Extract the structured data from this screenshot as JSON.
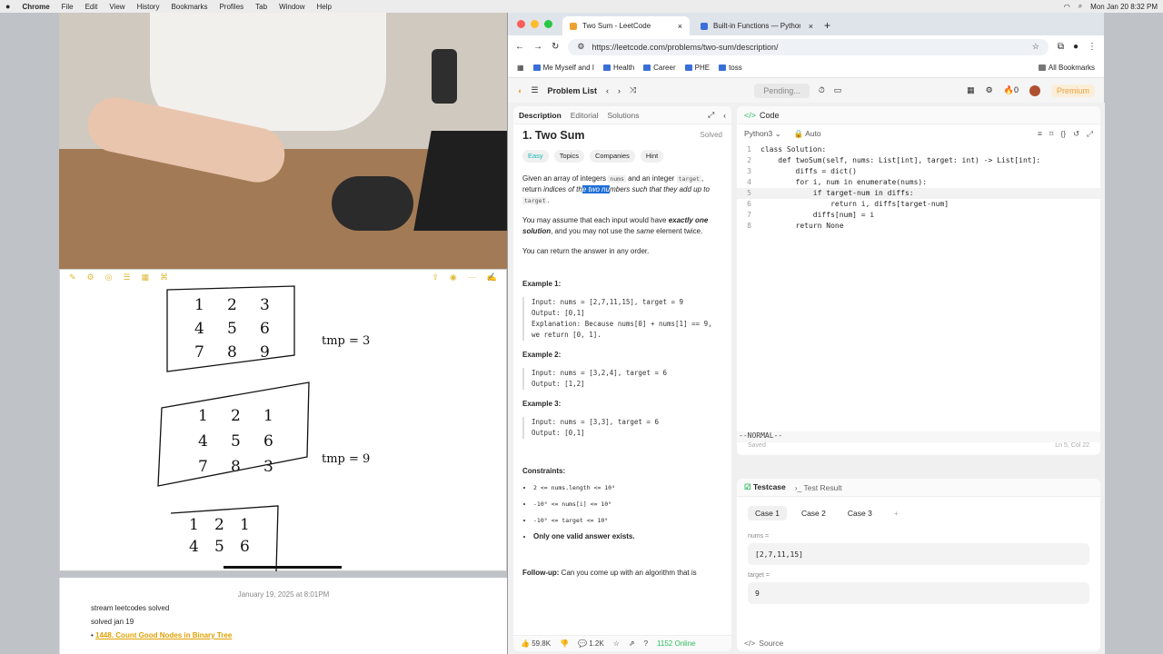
{
  "menubar": {
    "app": "Chrome",
    "items": [
      "File",
      "Edit",
      "View",
      "History",
      "Bookmarks",
      "Profiles",
      "Tab",
      "Window",
      "Help"
    ],
    "datetime": "Mon Jan 20  8:32 PM"
  },
  "notes": {
    "date": "January 19, 2025 at 8:01PM",
    "line1": "stream leetcodes solved",
    "line2": "solved jan 19",
    "link": "1448. Count Good Nodes in Binary Tree"
  },
  "whiteboard": {
    "grid1_label": "tmp = 3",
    "grid2_label": "tmp = 9",
    "grid1": [
      "1",
      "2",
      "3",
      "4",
      "5",
      "6",
      "7",
      "8",
      "9"
    ],
    "grid2": [
      "1",
      "2",
      "1",
      "4",
      "5",
      "6",
      "7",
      "8",
      "3"
    ],
    "grid3": [
      "1",
      "2",
      "1",
      "4",
      "5",
      "6"
    ]
  },
  "browser": {
    "tab1": "Two Sum - LeetCode",
    "tab2": "Built-in Functions — Python 3",
    "url": "https://leetcode.com/problems/two-sum/description/",
    "bookmarks": [
      "Me Myself and I",
      "Health",
      "Career",
      "PHE",
      "toss"
    ],
    "all_bookmarks": "All Bookmarks"
  },
  "lc": {
    "problem_list": "Problem List",
    "pending": "Pending...",
    "streak": "0",
    "premium": "Premium",
    "tabs": {
      "description": "Description",
      "editorial": "Editorial",
      "solutions": "Solutions"
    },
    "title": "1. Two Sum",
    "status": "Solved",
    "tags": {
      "difficulty": "Easy",
      "topics": "Topics",
      "companies": "Companies",
      "hint": "Hint"
    },
    "desc": {
      "p1a": "Given an array of integers ",
      "nums": "nums",
      "p1b": " and an integer ",
      "target": "target",
      "p1c": ", return ",
      "p1d": "indices of th",
      "highlight": "e two nu",
      "p1e": "mbers such that they add up to ",
      "p1f": ".",
      "p2a": "You may assume that each input would have ",
      "p2b": "exactly one solution",
      "p2c": ", and you may not use the ",
      "p2d": "same",
      "p2e": " element twice.",
      "p3": "You can return the answer in any order."
    },
    "examples": [
      {
        "title": "Example 1:",
        "input": "Input: nums = [2,7,11,15], target = 9",
        "output": "Output: [0,1]",
        "explanation": "Explanation: Because nums[0] + nums[1] == 9, we return [0, 1]."
      },
      {
        "title": "Example 2:",
        "input": "Input: nums = [3,2,4], target = 6",
        "output": "Output: [1,2]"
      },
      {
        "title": "Example 3:",
        "input": "Input: nums = [3,3], target = 6",
        "output": "Output: [0,1]"
      }
    ],
    "constraints_title": "Constraints:",
    "constraints": [
      "2 <= nums.length <= 10⁴",
      "-10⁹ <= nums[i] <= 10⁹",
      "-10⁹ <= target <= 10⁹"
    ],
    "constraint_bold": "Only one valid answer exists.",
    "followup_label": "Follow-up:",
    "followup": " Can you come up with an algorithm that is",
    "footer": {
      "likes": "59.8K",
      "comments": "1.2K",
      "online": "1152 Online"
    },
    "code": {
      "header": "Code",
      "language": "Python3",
      "mode": "Auto",
      "lines": [
        "class Solution:",
        "    def twoSum(self, nums: List[int], target: int) -> List[int]:",
        "        diffs = dict()",
        "        for i, num in enumerate(nums):",
        "            if target-num in diffs:",
        "                return i, diffs[target-num]",
        "            diffs[num] = i",
        "        return None"
      ],
      "vim": "--NORMAL--",
      "saved": "Saved",
      "position": "Ln 5, Col 22"
    },
    "test": {
      "testcase": "Testcase",
      "result": "Test Result",
      "cases": [
        "Case 1",
        "Case 2",
        "Case 3"
      ],
      "nums_label": "nums =",
      "nums": "[2,7,11,15]",
      "target_label": "target =",
      "target": "9",
      "source": "Source"
    }
  }
}
